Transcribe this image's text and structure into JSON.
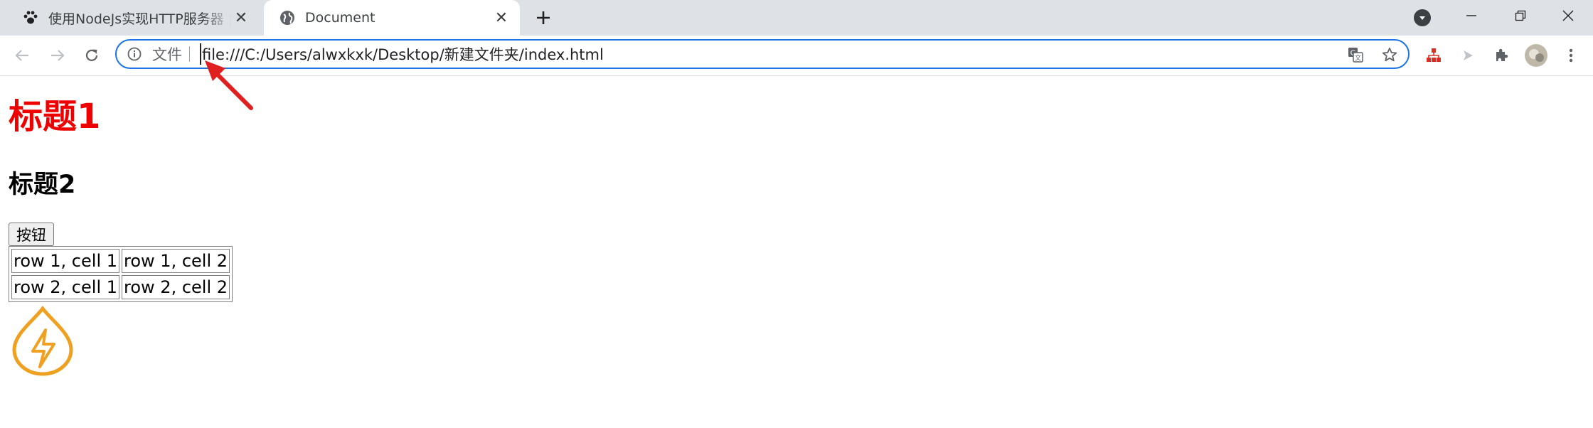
{
  "browser": {
    "tabs": [
      {
        "title": "使用NodeJs实现HTTP服务器 | 台",
        "icon": "paw-icon",
        "active": false
      },
      {
        "title": "Document",
        "icon": "globe-icon",
        "active": true
      }
    ],
    "address_bar": {
      "security_label": "文件",
      "url": "file:///C:/Users/alwxkxk/Desktop/新建文件夹/index.html"
    },
    "accent_color": "#1a73e8"
  },
  "page": {
    "heading1": "标题1",
    "heading2": "标题2",
    "button_label": "按钮",
    "table": {
      "rows": [
        [
          "row 1, cell 1",
          "row 1, cell 2"
        ],
        [
          "row 2, cell 1",
          "row 2, cell 2"
        ]
      ]
    },
    "heading1_color": "#ee0000",
    "logo_icon": "flash-drop-icon",
    "logo_color": "#f0a020"
  },
  "annotation": {
    "icon": "red-arrow-icon",
    "color": "#e02020"
  }
}
